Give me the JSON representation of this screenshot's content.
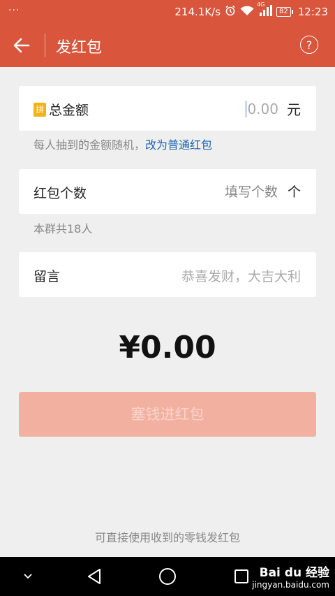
{
  "status_bar": {
    "dots": "···",
    "speed": "214.1K/s",
    "network": "4G",
    "battery": "82",
    "time": "12:23"
  },
  "app_bar": {
    "title": "发红包",
    "help": "?"
  },
  "amount_card": {
    "badge": "拼",
    "label": "总金额",
    "placeholder": "0.00",
    "unit": "元"
  },
  "amount_hint": {
    "text": "每人抽到的金额随机，",
    "link": "改为普通红包"
  },
  "count_card": {
    "label": "红包个数",
    "placeholder": "填写个数",
    "unit": "个"
  },
  "count_hint": "本群共18人",
  "message_card": {
    "label": "留言",
    "placeholder": "恭喜发财，大吉大利"
  },
  "total": "¥0.00",
  "submit_label": "塞钱进红包",
  "footer_hint": "可直接使用收到的零钱发红包",
  "watermark": {
    "brand": "Bai du 经验",
    "url": "jingyan.baidu.com"
  }
}
